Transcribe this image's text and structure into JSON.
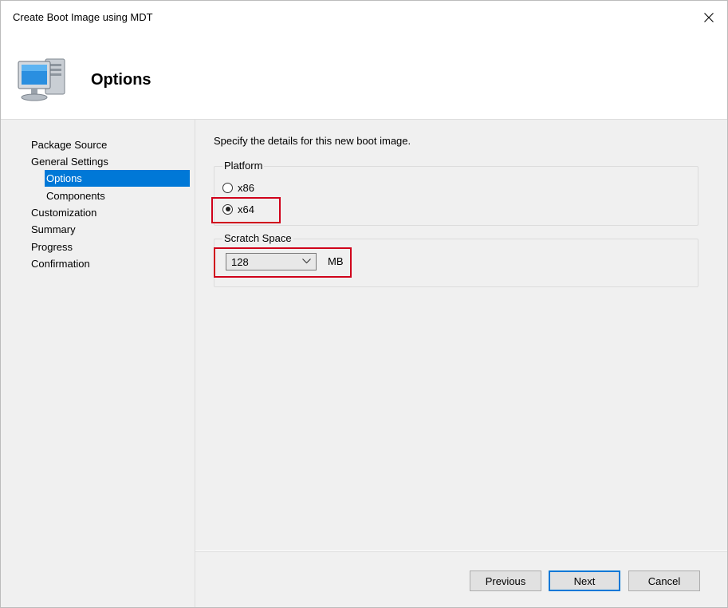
{
  "window": {
    "title": "Create Boot Image using MDT"
  },
  "header": {
    "title": "Options",
    "icon": "computer-icon"
  },
  "nav": {
    "items": [
      {
        "label": "Package Source",
        "level": 0,
        "selected": false
      },
      {
        "label": "General Settings",
        "level": 0,
        "selected": false
      },
      {
        "label": "Options",
        "level": 1,
        "selected": true
      },
      {
        "label": "Components",
        "level": 1,
        "selected": false
      },
      {
        "label": "Customization",
        "level": 0,
        "selected": false
      },
      {
        "label": "Summary",
        "level": 0,
        "selected": false
      },
      {
        "label": "Progress",
        "level": 0,
        "selected": false
      },
      {
        "label": "Confirmation",
        "level": 0,
        "selected": false
      }
    ]
  },
  "content": {
    "instruction": "Specify the details for this new boot image.",
    "platform": {
      "label": "Platform",
      "options": [
        {
          "label": "x86",
          "checked": false
        },
        {
          "label": "x64",
          "checked": true
        }
      ]
    },
    "scratch": {
      "label": "Scratch Space",
      "value": "128",
      "unit": "MB"
    }
  },
  "buttons": {
    "previous": "Previous",
    "next": "Next",
    "cancel": "Cancel"
  },
  "colors": {
    "selection": "#0078d7",
    "highlight": "#d0021b"
  }
}
